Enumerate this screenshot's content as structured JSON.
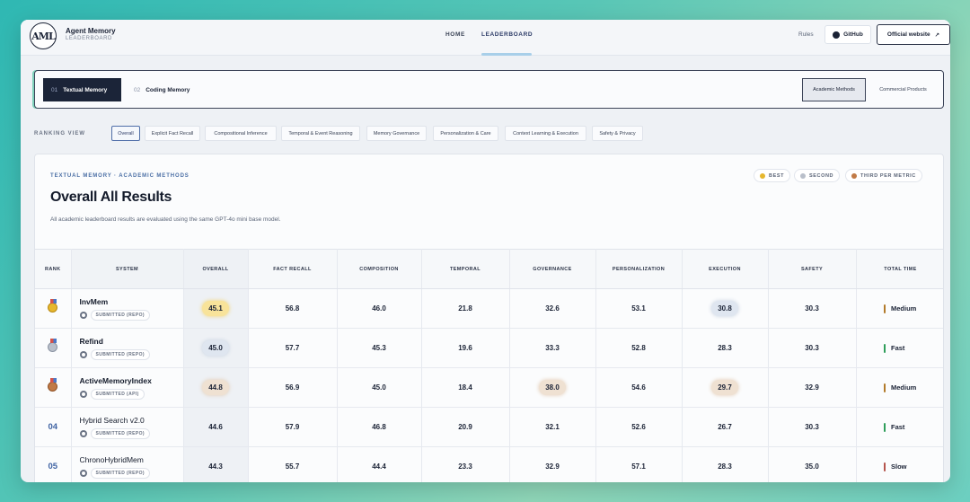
{
  "header": {
    "logo_text": "AML",
    "brand_title": "Agent Memory",
    "brand_sub": "LEADERBOARD",
    "nav": [
      {
        "label": "HOME"
      },
      {
        "label": "LEADERBOARD"
      }
    ],
    "rules_label": "Rules",
    "github_label": "GitHub",
    "official_label": "Official website",
    "official_icon": "↗"
  },
  "memory_tabs": [
    {
      "num": "01",
      "label": "Textual Memory",
      "active": true
    },
    {
      "num": "02",
      "label": "Coding Memory",
      "active": false
    }
  ],
  "method_tabs": [
    "Academic Methods",
    "Commercial Products"
  ],
  "ranking_view": {
    "label": "RANKING VIEW",
    "chips": [
      "Overall",
      "Explicit Fact Recall",
      "Compositional Inference",
      "Temporal & Event Reasoning",
      "Memory Governance",
      "Personalization & Care",
      "Context Learning & Execution",
      "Safety & Privacy"
    ]
  },
  "panel": {
    "crumb": "TEXTUAL MEMORY · ACADEMIC METHODS",
    "title": "Overall All Results",
    "desc": "All academic leaderboard results are evaluated using the same GPT-4o mini base model.",
    "legend": [
      "BEST",
      "SECOND",
      "THIRD PER METRIC"
    ]
  },
  "table": {
    "headers": [
      "RANK",
      "SYSTEM",
      "OVERALL",
      "FACT RECALL",
      "COMPOSITION",
      "TEMPORAL",
      "GOVERNANCE",
      "PERSONALIZATION",
      "EXECUTION",
      "SAFETY",
      "TOTAL TIME"
    ],
    "rows": [
      {
        "rank": "",
        "medal": "gold",
        "name": "InvMem",
        "badge": "SUBMITTED (REPO)",
        "overall": "45.1",
        "fact": "56.8",
        "comp": "46.0",
        "temporal": "21.8",
        "gov": "32.6",
        "pers": "53.1",
        "exec": "30.8",
        "safety": "30.3",
        "time": "Medium"
      },
      {
        "rank": "",
        "medal": "silver",
        "name": "Refind",
        "badge": "SUBMITTED (REPO)",
        "overall": "45.0",
        "fact": "57.7",
        "comp": "45.3",
        "temporal": "19.6",
        "gov": "33.3",
        "pers": "52.8",
        "exec": "28.3",
        "safety": "30.3",
        "time": "Fast"
      },
      {
        "rank": "",
        "medal": "bronze",
        "name": "ActiveMemoryIndex",
        "badge": "SUBMITTED (API)",
        "overall": "44.8",
        "fact": "56.9",
        "comp": "45.0",
        "temporal": "18.4",
        "gov": "38.0",
        "pers": "54.6",
        "exec": "29.7",
        "safety": "32.9",
        "time": "Medium"
      },
      {
        "rank": "04",
        "medal": "",
        "name": "Hybrid Search v2.0",
        "badge": "SUBMITTED (REPO)",
        "overall": "44.6",
        "fact": "57.9",
        "comp": "46.8",
        "temporal": "20.9",
        "gov": "32.1",
        "pers": "52.6",
        "exec": "26.7",
        "safety": "30.3",
        "time": "Fast"
      },
      {
        "rank": "05",
        "medal": "",
        "name": "ChronoHybridMem",
        "badge": "SUBMITTED (REPO)",
        "overall": "44.3",
        "fact": "55.7",
        "comp": "44.4",
        "temporal": "23.3",
        "gov": "32.9",
        "pers": "57.1",
        "exec": "28.3",
        "safety": "35.0",
        "time": "Slow"
      }
    ]
  },
  "colors": {
    "gold": "#e6b72e",
    "silver": "#b9bfca",
    "bronze": "#c17a46",
    "medium": "#b27a2a",
    "fast": "#2f9e5a",
    "slow": "#b5544c"
  }
}
